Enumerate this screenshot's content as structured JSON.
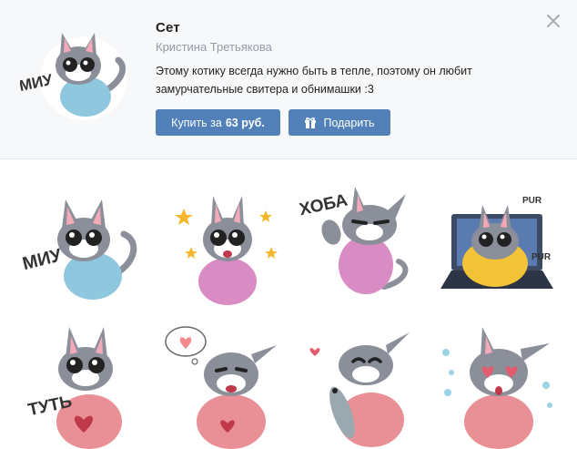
{
  "set": {
    "title": "Сет",
    "author": "Кристина Третьякова",
    "description": "Этому котику всегда нужно быть в тепле, поэтому он любит замурчательные свитера и обнимашки :3"
  },
  "buttons": {
    "buy_prefix": "Купить за",
    "buy_price": "63 руб.",
    "gift_label": "Подарить"
  },
  "colors": {
    "accent": "#5181b8",
    "header_bg": "#f7f8fa",
    "muted_text": "#939ba6"
  },
  "icons": {
    "close": "close-icon",
    "gift": "gift-icon"
  },
  "stickers": [
    {
      "caption": "МИУ",
      "sweater": "blue"
    },
    {
      "caption": "",
      "sweater": "pink",
      "decoration": "stars"
    },
    {
      "caption": "ХОБА",
      "sweater": "pink",
      "decoration": "wave"
    },
    {
      "caption": "PUR",
      "caption2": "PUR",
      "sweater": "yellow",
      "decoration": "laptop"
    },
    {
      "caption": "ТУТЬ",
      "sweater": "pink",
      "decoration": "heart"
    },
    {
      "caption": "",
      "sweater": "pink",
      "decoration": "heart-bubble"
    },
    {
      "caption": "",
      "sweater": "pink",
      "decoration": "fish"
    },
    {
      "caption": "",
      "sweater": "pink",
      "decoration": "hearts-eyes"
    }
  ]
}
